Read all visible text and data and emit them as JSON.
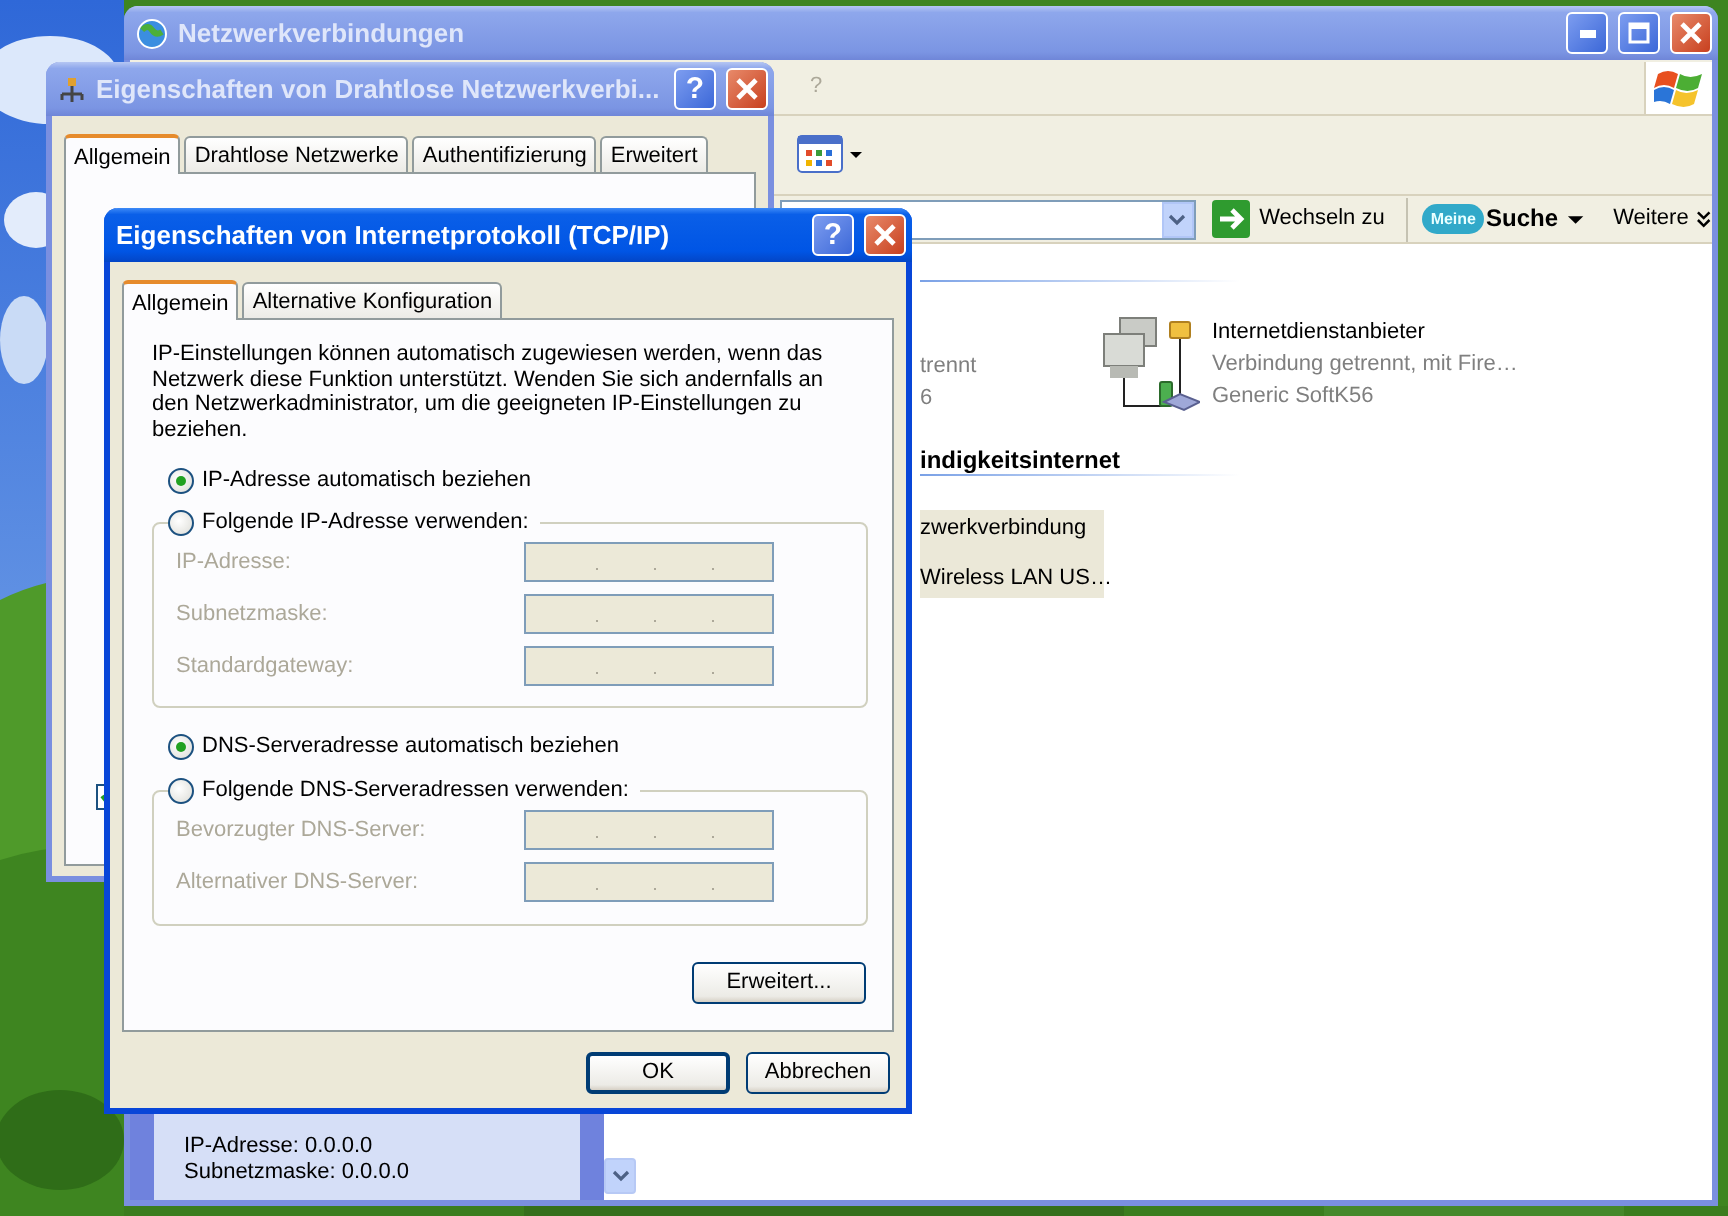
{
  "explorer": {
    "title": "Netzwerkverbindungen",
    "active": false,
    "menu": [
      {
        "label": "?",
        "disabled": true
      }
    ],
    "address_bar": {
      "go_label": "Wechseln zu"
    },
    "search_toolbar": {
      "logo_prefix": "Meine",
      "logo_label": "Suche",
      "more_label": "Weitere"
    },
    "connections": [
      {
        "kind": "cut",
        "lines": [
          "trennt",
          "6"
        ]
      },
      {
        "kind": "modem",
        "name": "Internetdienstanbieter",
        "lines": [
          "Verbindung getrennt, mit Fire…",
          "Generic SoftK56"
        ]
      }
    ],
    "section_heading": "indigkeitsinternet",
    "wireless_connection": {
      "lines": [
        "zwerkverbindung",
        "Wireless LAN US…"
      ],
      "selected": true
    },
    "details": [
      "IP-Adresse: 0.0.0.0",
      "Subnetzmaske: 0.0.0.0"
    ]
  },
  "wireless_dialog": {
    "title": "Eigenschaften von Drahtlose Netzwerkverbi...",
    "active": false,
    "help": "?",
    "tabs": [
      {
        "label": "Allgemein",
        "selected": true
      },
      {
        "label": "Drahtlose Netzwerke",
        "selected": false
      },
      {
        "label": "Authentifizierung",
        "selected": false
      },
      {
        "label": "Erweitert",
        "selected": false
      }
    ],
    "checkbox": {
      "checked": true
    }
  },
  "tcpip_dialog": {
    "title": "Eigenschaften von Internetprotokoll (TCP/IP)",
    "active": true,
    "help": "?",
    "tabs": [
      {
        "label": "Allgemein",
        "selected": true
      },
      {
        "label": "Alternative Konfiguration",
        "selected": false
      }
    ],
    "intro": "IP-Einstellungen können automatisch zugewiesen werden, wenn das Netzwerk diese Funktion unterstützt. Wenden Sie sich andernfalls an den Netzwerkadministrator, um die geeigneten IP-Einstellungen zu beziehen.",
    "ip_auto": {
      "label": "IP-Adresse automatisch beziehen",
      "selected": true
    },
    "ip_group": {
      "label": "Folgende IP-Adresse verwenden:",
      "selected": false,
      "fields": [
        {
          "label": "IP-Adresse:",
          "disabled": true
        },
        {
          "label": "Subnetzmaske:",
          "disabled": true
        },
        {
          "label": "Standardgateway:",
          "disabled": true
        }
      ]
    },
    "dns_auto": {
      "label": "DNS-Serveradresse automatisch beziehen",
      "selected": true
    },
    "dns_group": {
      "label": "Folgende DNS-Serveradressen verwenden:",
      "selected": false,
      "fields": [
        {
          "label": "Bevorzugter DNS-Server:",
          "disabled": true
        },
        {
          "label": "Alternativer DNS-Server:",
          "disabled": true
        }
      ]
    },
    "advanced_button": "Erweitert...",
    "buttons": [
      "OK",
      "Abbrechen"
    ]
  }
}
